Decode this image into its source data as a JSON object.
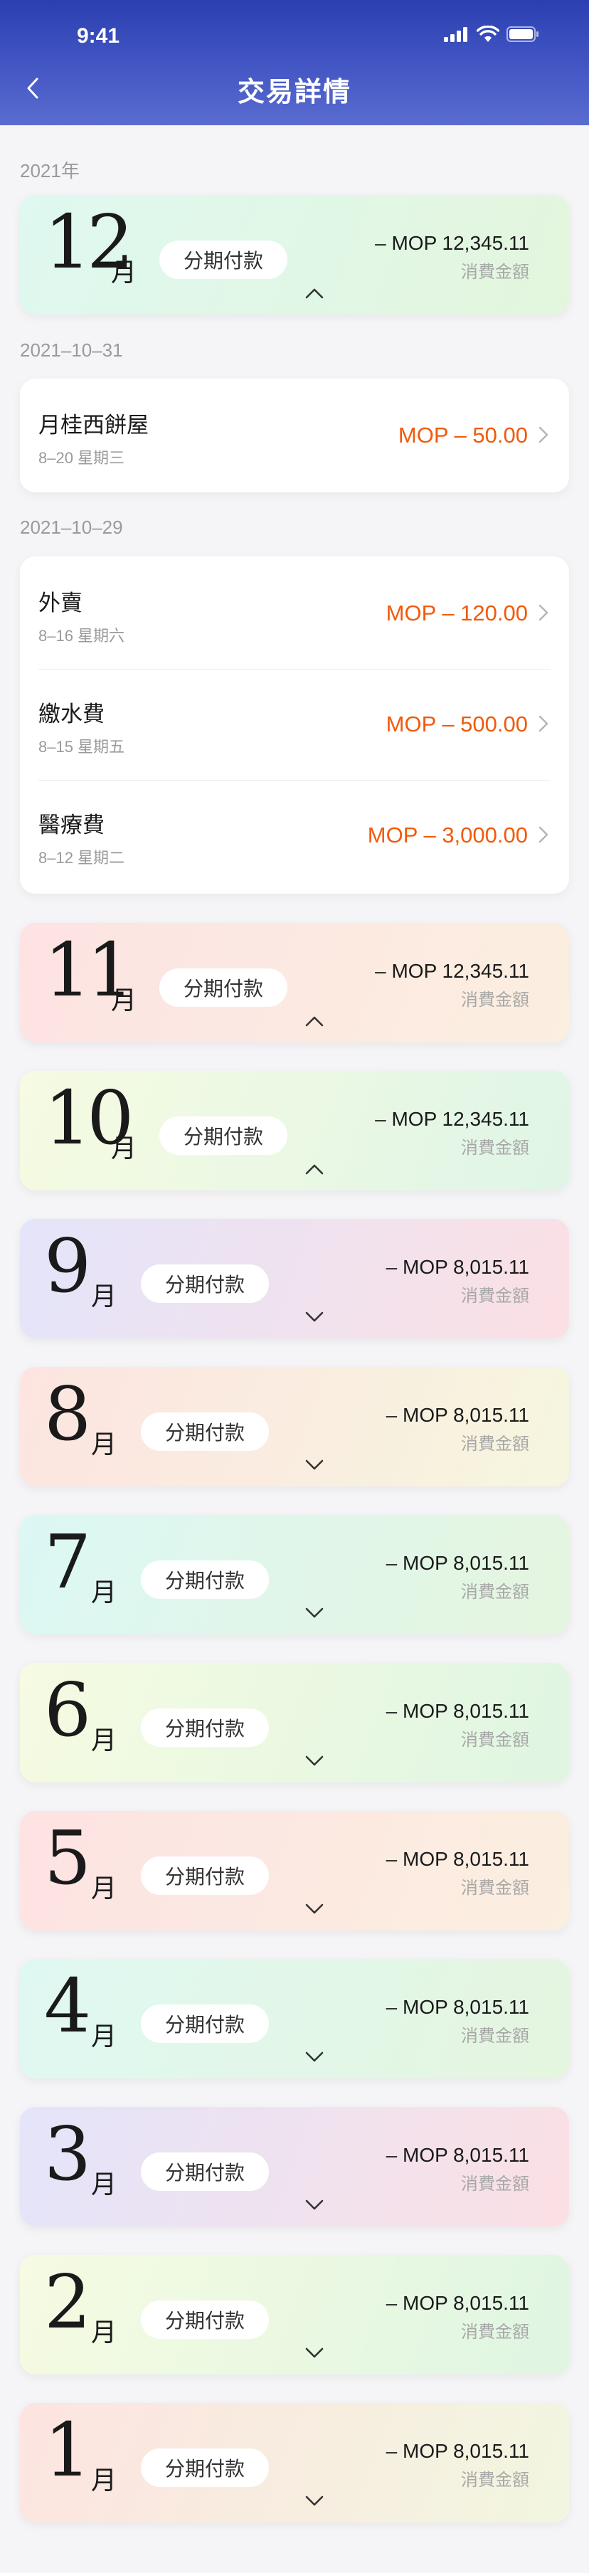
{
  "status": {
    "time": "9:41"
  },
  "header": {
    "title": "交易詳情"
  },
  "sections": {
    "year": "2021年",
    "date1": "2021–10–31",
    "date2": "2021–10–29"
  },
  "months": [
    {
      "num": "12",
      "unit": "月",
      "pill": "分期付款",
      "amount": "– MOP 12,345.11",
      "label": "消費金額",
      "expanded": true,
      "gradient": [
        "#dff8f0",
        "#e3f6dd"
      ]
    },
    {
      "num": "11",
      "unit": "月",
      "pill": "分期付款",
      "amount": "– MOP 12,345.11",
      "label": "消費金額",
      "expanded": true,
      "gradient": [
        "#fde3e3",
        "#fbefe0"
      ]
    },
    {
      "num": "10",
      "unit": "月",
      "pill": "分期付款",
      "amount": "– MOP 12,345.11",
      "label": "消費金額",
      "expanded": true,
      "gradient": [
        "#f6fbe2",
        "#dff5e6"
      ]
    },
    {
      "num": "9",
      "unit": "月",
      "pill": "分期付款",
      "amount": "– MOP 8,015.11",
      "label": "消費金額",
      "expanded": false,
      "gradient": [
        "#e4e4fa",
        "#fbe0e4"
      ]
    },
    {
      "num": "8",
      "unit": "月",
      "pill": "分期付款",
      "amount": "– MOP 8,015.11",
      "label": "消費金額",
      "expanded": false,
      "gradient": [
        "#fde4e0",
        "#f6f6df"
      ]
    },
    {
      "num": "7",
      "unit": "月",
      "pill": "分期付款",
      "amount": "– MOP 8,015.11",
      "label": "消費金額",
      "expanded": false,
      "gradient": [
        "#dcf7f4",
        "#e5f6df"
      ]
    },
    {
      "num": "6",
      "unit": "月",
      "pill": "分期付款",
      "amount": "– MOP 8,015.11",
      "label": "消費金額",
      "expanded": false,
      "gradient": [
        "#f6fbe2",
        "#dff6e2"
      ]
    },
    {
      "num": "5",
      "unit": "月",
      "pill": "分期付款",
      "amount": "– MOP 8,015.11",
      "label": "消費金額",
      "expanded": false,
      "gradient": [
        "#fde3e3",
        "#fbefe0"
      ]
    },
    {
      "num": "4",
      "unit": "月",
      "pill": "分期付款",
      "amount": "– MOP 8,015.11",
      "label": "消費金額",
      "expanded": false,
      "gradient": [
        "#dff8f2",
        "#e5f6df"
      ]
    },
    {
      "num": "3",
      "unit": "月",
      "pill": "分期付款",
      "amount": "– MOP 8,015.11",
      "label": "消費金額",
      "expanded": false,
      "gradient": [
        "#e4e4fa",
        "#fbe0e4"
      ]
    },
    {
      "num": "2",
      "unit": "月",
      "pill": "分期付款",
      "amount": "– MOP 8,015.11",
      "label": "消費金額",
      "expanded": false,
      "gradient": [
        "#f6fbe2",
        "#dff6e2"
      ]
    },
    {
      "num": "1",
      "unit": "月",
      "pill": "分期付款",
      "amount": "– MOP 8,015.11",
      "label": "消費金額",
      "expanded": false,
      "gradient": [
        "#fde4e0",
        "#f2f6e0"
      ]
    }
  ],
  "tx_group1": [
    {
      "name": "月桂西餅屋",
      "date": "8–20 星期三",
      "amount": "MOP – 50.00"
    }
  ],
  "tx_group2": [
    {
      "name": "外賣",
      "date": "8–16 星期六",
      "amount": "MOP – 120.00"
    },
    {
      "name": "繳水費",
      "date": "8–15 星期五",
      "amount": "MOP – 500.00"
    },
    {
      "name": "醫療費",
      "date": "8–12 星期二",
      "amount": "MOP – 3,000.00"
    }
  ],
  "colors": {
    "header": "#3447b8",
    "amount_orange": "#f15a0b",
    "background": "#f5f5f7"
  },
  "icons": {
    "back": "chevron-left-icon",
    "signal": "signal-icon",
    "wifi": "wifi-icon",
    "battery": "battery-icon",
    "expand": "chevron-up-icon",
    "collapse": "chevron-down-icon",
    "row": "chevron-right-icon"
  }
}
